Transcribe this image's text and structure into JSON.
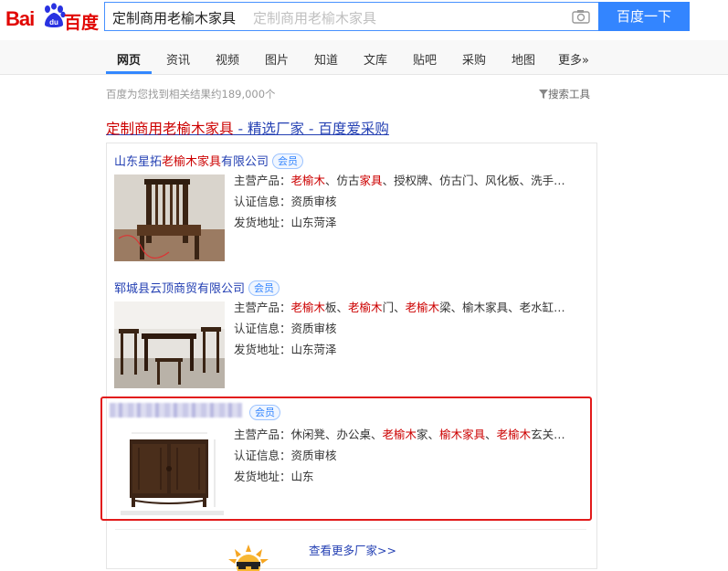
{
  "header": {
    "logo_bai": "Bai",
    "logo_du": "du",
    "logo_cn": "百度",
    "query": "定制商用老榆木家具",
    "placeholder": "定制商用老榆木家具",
    "search_button": "百度一下"
  },
  "tabs": [
    "网页",
    "资讯",
    "视频",
    "图片",
    "知道",
    "文库",
    "贴吧",
    "采购",
    "地图",
    "更多»"
  ],
  "stats": "百度为您找到相关结果约189,000个",
  "tools": "搜索工具",
  "ad": {
    "title_pre": "定制商用",
    "title_hl": "老榆木家具",
    "title_post": " - 精选厂家 - 百度爱采购"
  },
  "badge": "会员",
  "companies": [
    {
      "name_pre": "山东星拓",
      "name_hl": "老榆木家具",
      "name_post": "有限公司",
      "products_label": "主营产品：",
      "products": [
        {
          "t": "老榆木",
          "r": true
        },
        {
          "t": "、仿古",
          "r": false
        },
        {
          "t": "家具",
          "r": true
        },
        {
          "t": "、授权牌、仿古门、风化板、洗手…",
          "r": false
        }
      ],
      "cert": "认证信息：资质审核",
      "ship": "发货地址：山东菏泽"
    },
    {
      "name_pre": "郓城县云顶商贸有限公司",
      "name_hl": "",
      "name_post": "",
      "products_label": "主营产品：",
      "products": [
        {
          "t": "老榆木",
          "r": true
        },
        {
          "t": "板、",
          "r": false
        },
        {
          "t": "老榆木",
          "r": true
        },
        {
          "t": "门、",
          "r": false
        },
        {
          "t": "老榆木",
          "r": true
        },
        {
          "t": "梁、榆木家具、老水缸…",
          "r": false
        }
      ],
      "cert": "认证信息：资质审核",
      "ship": "发货地址：山东菏泽"
    },
    {
      "name_pre": "",
      "name_hl": "",
      "name_post": "",
      "products_label": "主营产品：",
      "products": [
        {
          "t": "休闲凳、办公桌、",
          "r": false
        },
        {
          "t": "老榆木",
          "r": true
        },
        {
          "t": "家、",
          "r": false
        },
        {
          "t": "榆木家具",
          "r": true
        },
        {
          "t": "、",
          "r": false
        },
        {
          "t": "老榆木",
          "r": true
        },
        {
          "t": "玄关…",
          "r": false
        }
      ],
      "cert": "认证信息：资质审核",
      "ship": "发货地址：山东"
    }
  ],
  "more_link": "查看更多厂家>>",
  "colors": {
    "accent": "#3385ff",
    "link": "#2440b3",
    "highlight_red": "#c00",
    "box_red": "#e21a1a"
  }
}
